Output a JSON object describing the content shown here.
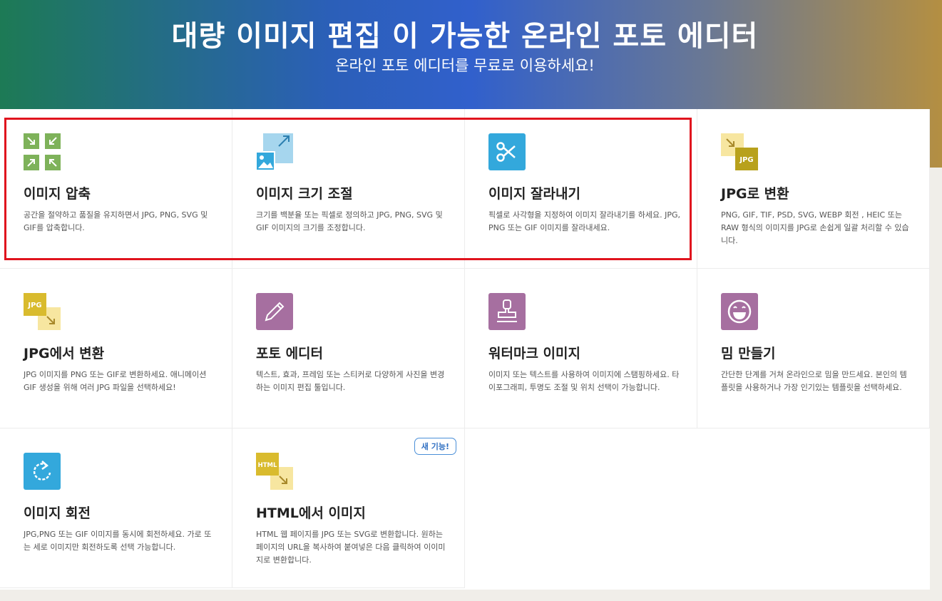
{
  "hero": {
    "title": "대량 이미지 편집 이 가능한 온라인 포토 에디터",
    "subtitle": "온라인 포토 에디터를 무료로 이용하세요!"
  },
  "colors": {
    "green": "#7eb25a",
    "lightblue": "#a6d6ee",
    "blue": "#33a8dc",
    "yellow": "#d9bb2e",
    "paleyellow": "#f7e6a0",
    "purple": "#a66fa0",
    "highlight": "#e0141e"
  },
  "tools": [
    {
      "icon": "compress-arrows-icon",
      "title": "이미지 압축",
      "desc": "공간을 절약하고 품질을 유지하면서 JPG, PNG, SVG 및 GIF를 압축합니다."
    },
    {
      "icon": "resize-image-icon",
      "title": "이미지 크기 조절",
      "desc": "크기를 백분율 또는 픽셀로 정의하고 JPG, PNG, SVG 및 GIF 이미지의 크기를 조정합니다."
    },
    {
      "icon": "scissors-icon",
      "title": "이미지 잘라내기",
      "desc": "픽셀로 사각형을 지정하여 이미지 잘라내기를 하세요. JPG, PNG 또는 GIF 이미지를 잘라내세요."
    },
    {
      "icon": "to-jpg-icon",
      "icon_text": "JPG",
      "title": "JPG로 변환",
      "desc": "PNG, GIF, TIF, PSD, SVG, WEBP 회전 , HEIC 또는 RAW 형식의 이미지를 JPG로 손쉽게 일괄 처리할 수 있습니다."
    },
    {
      "icon": "from-jpg-icon",
      "icon_text": "JPG",
      "title": "JPG에서 변환",
      "desc": "JPG 이미지를 PNG 또는 GIF로 변환하세요. 애니메이션 GIF 생성을 위해 여러 JPG 파일을 선택하세요!"
    },
    {
      "icon": "pencil-icon",
      "title": "포토 에디터",
      "desc": "텍스트, 효과, 프레임 또는 스티커로 다양하게 사진을 변경하는 이미지 편집 툴입니다."
    },
    {
      "icon": "stamp-icon",
      "title": "워터마크 이미지",
      "desc": "이미지 또는 텍스트를 사용하여 이미지에 스탬핑하세요. 타이포그래피, 투명도 조절 및 위치 선택이 가능합니다."
    },
    {
      "icon": "laughing-face-icon",
      "title": "밈 만들기",
      "desc": "간단한 단계를 거쳐 온라인으로 밈을 만드세요. 본인의 템플릿을 사용하거나 가장 인기있는 템플릿을 선택하세요."
    },
    {
      "icon": "rotate-icon",
      "title": "이미지 회전",
      "desc": "JPG,PNG 또는 GIF 이미지를 동시에 회전하세요. 가로 또는 세로 이미지만 회전하도록 선택 가능합니다."
    },
    {
      "icon": "html-to-image-icon",
      "icon_text": "HTML",
      "title": "HTML에서 이미지",
      "desc": "HTML 웹 페이지를 JPG 또는 SVG로 변환합니다. 원하는 페이지의 URL을 복사하여 붙여넣은 다음 클릭하여 이이미지로 변환합니다.",
      "badge": "새 기능!"
    }
  ]
}
